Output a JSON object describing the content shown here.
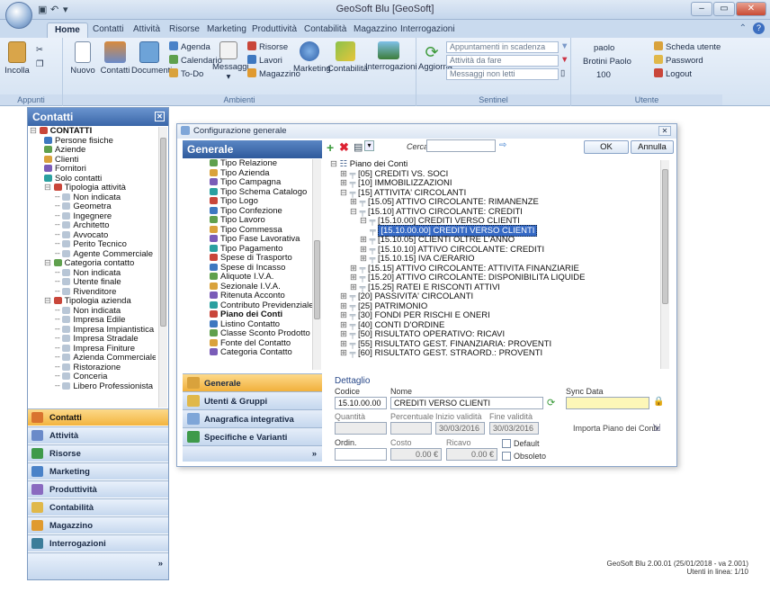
{
  "app": {
    "title": "GeoSoft Blu [GeoSoft]"
  },
  "ribbon": {
    "tabs": [
      "Home",
      "Contatti",
      "Attività",
      "Risorse",
      "Marketing",
      "Produttività",
      "Contabilità",
      "Magazzino",
      "Interrogazioni"
    ],
    "appunti": {
      "label": "Appunti",
      "incolla": "Incolla"
    },
    "ambienti": {
      "label": "Ambienti",
      "nuovo": "Nuovo",
      "contatti": "Contatti",
      "documenti": "Documenti",
      "agenda": "Agenda",
      "calendario": "Calendario",
      "todo": "To-Do",
      "messaggi": "Messaggi",
      "risorse": "Risorse",
      "lavori": "Lavori",
      "magazzino": "Magazzino",
      "marketing": "Marketing",
      "contabilita": "Contabilità",
      "interrogazioni": "Interrogazioni"
    },
    "sentinel": {
      "label": "Sentinel",
      "aggiorna": "Aggiorna",
      "appuntamenti": "Appuntamenti in scadenza",
      "attivita": "Attività da fare",
      "messaggi": "Messaggi non letti"
    },
    "utente": {
      "label": "Utente",
      "user": "paolo",
      "name": "Brotini Paolo",
      "value": "100",
      "scheda": "Scheda utente",
      "password": "Password",
      "logout": "Logout"
    }
  },
  "left": {
    "title": "Contatti",
    "tree": [
      {
        "t": "CONTATTI",
        "d": 0,
        "b": true
      },
      {
        "t": "Persone fisiche",
        "d": 1
      },
      {
        "t": "Aziende",
        "d": 1
      },
      {
        "t": "Clienti",
        "d": 1
      },
      {
        "t": "Fornitori",
        "d": 1
      },
      {
        "t": "Solo contatti",
        "d": 1
      },
      {
        "t": "Tipologia attività",
        "d": 1
      },
      {
        "t": "Non indicata",
        "d": 2
      },
      {
        "t": "Geometra",
        "d": 2
      },
      {
        "t": "Ingegnere",
        "d": 2
      },
      {
        "t": "Architetto",
        "d": 2
      },
      {
        "t": "Avvocato",
        "d": 2
      },
      {
        "t": "Perito Tecnico",
        "d": 2
      },
      {
        "t": "Agente Commerciale",
        "d": 2
      },
      {
        "t": "Categoria contatto",
        "d": 1
      },
      {
        "t": "Non indicata",
        "d": 2
      },
      {
        "t": "Utente finale",
        "d": 2
      },
      {
        "t": "Rivenditore",
        "d": 2
      },
      {
        "t": "Tipologia azienda",
        "d": 1
      },
      {
        "t": "Non indicata",
        "d": 2
      },
      {
        "t": "Impresa Edile",
        "d": 2
      },
      {
        "t": "Impresa Impiantistica",
        "d": 2
      },
      {
        "t": "Impresa Stradale",
        "d": 2
      },
      {
        "t": "Impresa Finiture",
        "d": 2
      },
      {
        "t": "Azienda Commerciale",
        "d": 2
      },
      {
        "t": "Ristorazione",
        "d": 2
      },
      {
        "t": "Conceria",
        "d": 2
      },
      {
        "t": "Libero Professionista",
        "d": 2
      }
    ],
    "nav": [
      "Contatti",
      "Attività",
      "Risorse",
      "Marketing",
      "Produttività",
      "Contabilità",
      "Magazzino",
      "Interrogazioni"
    ]
  },
  "dialog": {
    "title": "Configurazione generale",
    "header": "Generale",
    "search_label": "Cerca:",
    "ok": "OK",
    "annulla": "Annulla",
    "list": [
      "Tipo Relazione",
      "Tipo Azienda",
      "Tipo Campagna",
      "Tipo Schema Catalogo",
      "Tipo Logo",
      "Tipo Confezione",
      "Tipo Lavoro",
      "Tipo Commessa",
      "Tipo Fase Lavorativa",
      "Tipo Pagamento",
      "Spese di Trasporto",
      "Spese di Incasso",
      "Aliquote I.V.A.",
      "Sezionale I.V.A.",
      "Ritenuta Acconto",
      "Contributo Previdenziale",
      "Piano dei Conti",
      "Listino Contatto",
      "Classe Sconto Prodotto",
      "Fonte del Contatto",
      "Categoria Contatto"
    ],
    "list_bold": "Piano dei Conti",
    "nav": [
      "Generale",
      "Utenti & Gruppi",
      "Anagrafica integrativa",
      "Specifiche e Varianti"
    ],
    "tree": [
      {
        "t": "Piano dei Conti",
        "d": 0
      },
      {
        "t": "[05] CREDITI VS. SOCI",
        "d": 1
      },
      {
        "t": "[10] IMMOBILIZZAZIONI",
        "d": 1
      },
      {
        "t": "[15] ATTIVITA' CIRCOLANTI",
        "d": 1
      },
      {
        "t": "[15.05] ATTIVO CIRCOLANTE: RIMANENZE",
        "d": 2
      },
      {
        "t": "[15.10] ATTIVO CIRCOLANTE: CREDITI",
        "d": 2
      },
      {
        "t": "[15.10.00] CREDITI VERSO CLIENTI",
        "d": 3
      },
      {
        "t": "[15.10.00.00] CREDITI VERSO CLIENTI",
        "d": 4,
        "sel": true
      },
      {
        "t": "[15.10.05] CLIENTI OLTRE L'ANNO",
        "d": 3
      },
      {
        "t": "[15.10.10] ATTIVO CIRCOLANTE: CREDITI",
        "d": 3
      },
      {
        "t": "[15.10.15] IVA C/ERARIO",
        "d": 3
      },
      {
        "t": "[15.15] ATTIVO CIRCOLANTE: ATTIVITA FINANZIARIE",
        "d": 2
      },
      {
        "t": "[15.20] ATTIVO CIRCOLANTE: DISPONIBILITA LIQUIDE",
        "d": 2
      },
      {
        "t": "[15.25] RATEI E RISCONTI ATTIVI",
        "d": 2
      },
      {
        "t": "[20] PASSIVITA' CIRCOLANTI",
        "d": 1
      },
      {
        "t": "[25] PATRIMONIO",
        "d": 1
      },
      {
        "t": "[30] FONDI PER RISCHI E ONERI",
        "d": 1
      },
      {
        "t": "[40] CONTI D'ORDINE",
        "d": 1
      },
      {
        "t": "[50] RISULTATO OPERATIVO: RICAVI",
        "d": 1
      },
      {
        "t": "[55] RISULTATO GEST. FINANZIARIA: PROVENTI",
        "d": 1
      },
      {
        "t": "[60] RISULTATO GEST. STRAORD.: PROVENTI",
        "d": 1
      }
    ],
    "detail": {
      "title": "Dettaglio",
      "codice_label": "Codice",
      "codice": "15.10.00.00",
      "nome_label": "Nome",
      "nome": "CREDITI VERSO CLIENTI",
      "sync_label": "Sync Data",
      "quantita_label": "Quantità",
      "percentuale_label": "Percentuale",
      "inizio_label": "Inizio validità",
      "inizio": "30/03/2016",
      "fine_label": "Fine validità",
      "fine": "30/03/2016",
      "importa": "Importa Piano dei Conti:",
      "ordin_label": "Ordin.",
      "costo_label": "Costo",
      "costo": "0.00 €",
      "ricavo_label": "Ricavo",
      "ricavo": "0.00 €",
      "default": "Default",
      "obsoleto": "Obsoleto"
    }
  },
  "status": {
    "version": "GeoSoft Blu 2.00.01 (25/01/2018 - va 2.001)",
    "users": "Utenti in linea: 1/10"
  }
}
